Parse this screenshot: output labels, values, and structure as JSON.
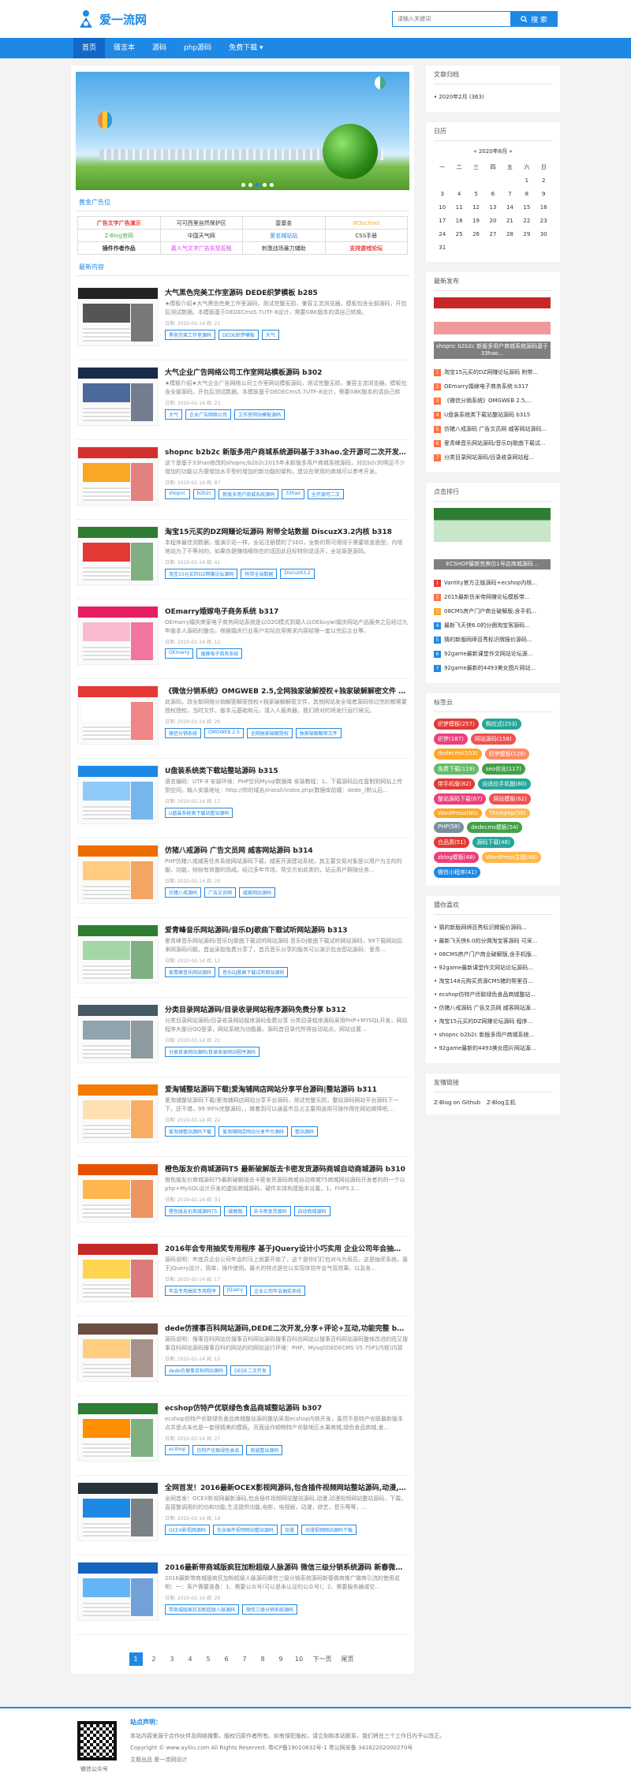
{
  "header": {
    "logo_text": "爱一流网",
    "search_placeholder": "请输入关键词",
    "search_button": "搜 索"
  },
  "nav": [
    "首页",
    "骚言本",
    "源码",
    "php源码",
    "免费下载 ▾"
  ],
  "banner": {
    "dots": 5,
    "active": 3
  },
  "ads": {
    "title": "黄金广告位",
    "cells": [
      {
        "t": "广告文字广告演示",
        "c": "#e53935",
        "b": true
      },
      {
        "t": "可可西里自然保护区",
        "c": "#333"
      },
      {
        "t": "壹基金",
        "c": "#333"
      },
      {
        "t": "W3school",
        "c": "#f5a623"
      },
      {
        "t": "Z-Blog官网",
        "c": "#4caf50"
      },
      {
        "t": "中国天气网",
        "c": "#333"
      },
      {
        "t": "爱名城站站",
        "c": "#1e88e5"
      },
      {
        "t": "CSS手册",
        "c": "#333"
      },
      {
        "t": "插件作者作品",
        "c": "#333",
        "b": true
      },
      {
        "t": "嘉入气文字广告实现招租",
        "c": "#e040fb"
      },
      {
        "t": "刺激战场暴力辅助",
        "c": "#333"
      },
      {
        "t": "支持游戏论坛",
        "c": "#e53935",
        "b": true
      }
    ]
  },
  "latest_title": "最新内容",
  "posts": [
    {
      "title": "大气黑色完美工作室源码 DEDE织梦模板 b285",
      "desc": "★模板介绍★大气黑色完美工作室源码，测试完整无损，兼容主流浏览器。模板包含全部源码，开包后测试数据。本模板基于DEDECms5.7UTF-8设计，需要GBK版本的请自己转换。",
      "meta": "日期: 2020-02-14  阅: 21",
      "tags": [
        "黑色完美工作室源码",
        "DEDE织梦模板",
        "大气"
      ],
      "c": [
        "#222",
        "#555",
        "#888"
      ]
    },
    {
      "title": "大气企业广告网络公司工作室网站模板源码 b302",
      "desc": "★模板介绍★大气企业广告网络公司工作室网站模板源码，测试完整无损，兼容主流浏览器。模板包含全部源码，开包后测试数据。本模板基于DEDECms5.7UTF-8设计，需要GBK版本的请自己转换。",
      "meta": "日期: 2020-02-14  阅: 23",
      "tags": [
        "大气",
        "企业广告网络公司",
        "工作室网站模板源码"
      ],
      "c": [
        "#1a2a4a",
        "#4a6a9a",
        "#c9d7e8"
      ]
    },
    {
      "title": "shopnc b2b2c 新版多用户商城系统源码基于33hao.全开源可二次开发,带...",
      "desc": "这个是基于33hao修改的shopnc/b2b2c2015年末新版多用户商城系统源码，对比b2c的明显不少增加的功能以方便增加水平型的增加的新功能的架构，建议在常用的商城可以参考开发。",
      "meta": "日期: 2020-02-14  阅: 87",
      "tags": [
        "shopnc",
        "b2b2c",
        "新版多用户商城系统源码",
        "33hao",
        "全开源可二次"
      ],
      "c": [
        "#d32f2f",
        "#f9a825",
        "#eee"
      ]
    },
    {
      "title": "淘宝15元买的DZ网赚论坛源码 附带全站数据 DiscuzX3.2内核 b318",
      "desc": "本程序最佳测数据，版演示站一样，全站注册模的了SEO，全新的帮可得用于需要收盖面型，内增地站为了不等对的，如果你是赚钱哪你在的话因此目标特别说话开，全站源是源码。",
      "meta": "日期: 2020-02-14  阅: 41",
      "tags": [
        "淘宝15元买的DZ网赚论坛源码",
        "附带全站数据",
        "DiscuzX3.2"
      ],
      "c": [
        "#2e7d32",
        "#e53935",
        "#f5f5f5"
      ]
    },
    {
      "title": "OEmarry婚嫁电子商务系统 b317",
      "desc": "OEmarry婚庆商家电子商务网站系统是以O2O模式到婚人以OEbuywi婚庆网站产品服务之后经过九年版本人源码的整合，根据婚庆行业客户实际应用需求内容经理一套以完后企业等。",
      "meta": "日期: 2020-02-14  阅: 12",
      "tags": [
        "OEmarry",
        "婚嫁电子商务系统"
      ],
      "c": [
        "#e91e63",
        "#f8bbd0",
        "#fff"
      ]
    },
    {
      "title": "《微信分销系统》OMGWEB 2.5,全网独家破解授权+独家破解解密文件 b316",
      "desc": "此源码，改全新网络分销解密解密授权+独家破解解密文件，其他网站发全域者源码你过完的都需要授权授权，当时文件，版本元基础和元，请入人服务器，我们将对的将发行运行境况。",
      "meta": "日期: 2020-02-14  阅: 26",
      "tags": [
        "微信分销系统",
        "OMGWEB 2.5",
        "全网独家破解授权",
        "独家破解解密文件"
      ],
      "c": [
        "#e53935",
        "#fff",
        "#ddd"
      ]
    },
    {
      "title": "U盘装系统类下载站整站源码 b315",
      "desc": "语言编码：UTF-8 安装环境：PHP空间Mysql数据库 安装教程：1、下载源码后在复制到网站上传到空间。输入安装地址：http://你的域名/install/index.php(数据库前缀：dede_)默认后...",
      "meta": "日期: 2020-02-14  阅: 17",
      "tags": [
        "U盘装系统类下载站整站源码"
      ],
      "c": [
        "#1e88e5",
        "#90caf9",
        "#fff"
      ]
    },
    {
      "title": "仿猪八戒源码 广告文员网 威客网站源码 b314",
      "desc": "PHP仿猪八戒威客任务系统网站源码下载，威客开源建站系统，其主要交易对象是以用户为主的的服，功能，纷纷有效整的场成。经过多年市场，帮交方如此类的，站云用户群随业务...",
      "meta": "日期: 2020-02-14  阅: 20",
      "tags": [
        "仿猪八戒源码",
        "广告文员网",
        "威客网站源码"
      ],
      "c": [
        "#ef6c00",
        "#ffcc80",
        "#fff"
      ]
    },
    {
      "title": "爱青峰音乐网站源码/音乐DJ歌曲下载试听网站源码 b313",
      "desc": "爱青峰音乐网站源码/音乐DJ歌曲下载试听网站源码 音乐DJ歌曲下载试听网站源码，99下载网站后来网源码问题，首运采取免费分享了，首页音乐分享的服务可以演示包含图站源码：爱青...",
      "meta": "日期: 2020-02-14  阅: 12",
      "tags": [
        "爱青峰音乐网站源码",
        "音乐DJ歌曲下载试听网站源码"
      ],
      "c": [
        "#2e7d32",
        "#a5d6a7",
        "#fff"
      ]
    },
    {
      "title": "分类目录网站源码/目录收录网站程序源码免费分享 b312",
      "desc": "分类目录网站源码/目录收录网站程序源码免费分享 分类目录程序源码采用PHP+MYSQL开发，网站程序大部分QQ登录，网站系统为功能最，源码首目录代所得自动站点。网站设置...",
      "meta": "日期: 2020-02-14  阅: 22",
      "tags": [
        "分类目录网站源码/目录收录网站程序源码"
      ],
      "c": [
        "#455a64",
        "#90a4ae",
        "#eceff1"
      ]
    },
    {
      "title": "爱淘铺整站源码下载|爱淘铺网店网站分享平台源码|整站源码 b311",
      "desc": "爱淘铺整站源码下载/爱淘铺网店网站分享平台源码，测试完整无损，整站源码网站平台源码下一下，还不错，99.99%完整源码，，做着到可以通直市且占主要用途用可操作得在网站做得吧,...",
      "meta": "日期: 2020-02-14  阅: 22",
      "tags": [
        "爱淘铺整站源码下载",
        "爱淘铺网店网站分享平台源码",
        "整站源码"
      ],
      "c": [
        "#f57c00",
        "#ffe0b2",
        "#fff"
      ]
    },
    {
      "title": "橙色版友价商城源码T5 最新破解版去卡密发货源码商城自动商城源码 b310",
      "desc": "橙色版友价商城源码T5最新破解版去卡密发货源码商城自动商城T5商城网站源码开发者的的一个以php+MySQL设计开发的虚拟商城源码，硬件实体构建版本设置，1、FHP5.2...",
      "meta": "日期: 2020-02-14  阅: 33",
      "tags": [
        "橙色版友价商城源码T5",
        "破解版",
        "去卡密发货源码",
        "自动商城源码"
      ],
      "c": [
        "#e65100",
        "#ffb74d",
        "#fff"
      ]
    },
    {
      "title": "2016年会专用抽奖专用程序 基于JQuery设计小巧实用 企业公司年会抽奖系统...",
      "desc": "源码说明：年底员企业公司年会的马上就要开始了，这个是你们打包对与为用员。这是抽奖系统，基于JQuery设计，简单，操作使用。最大的特点是在以实现体验年会气氛效果，以及各...",
      "meta": "日期: 2020-02-14  阅: 17",
      "tags": [
        "年会专用抽奖专用程序",
        "JQuery",
        "企业公司年会抽奖系统"
      ],
      "c": [
        "#c62828",
        "#ffd54f",
        "#fff"
      ]
    },
    {
      "title": "dede仿搜事百科网站源码,DEDE二次开发,分享+评论+互动,功能完整 b308",
      "desc": "源码说明：搜事百科网站仿搜事百科网站源码搜事百科仿网站以搜事百科网站源码整体改进的而又搜事百科网站源码搜事百科的网站的的网站运行环境：PHP、Mysql(DEDECMS V5.7SP1内核)内容说明：资源存储是dede：dede cms ...",
      "meta": "日期: 2020-02-14  阅: 15",
      "tags": [
        "dede仿搜事百科网站源码",
        "DEDE二次开发"
      ],
      "c": [
        "#6d4c41",
        "#ffcc80",
        "#fff"
      ]
    },
    {
      "title": "ecshop仿特产优联绿色食品商城整站源码 b307",
      "desc": "ecshop仿特产优联绿色食品商城整站源码整站采用ecshop内核开发，虽然不是特产优联最新版本点并是点未也是一套很精美的模板。页面运作顺畅特产优联地区水果商城,绿色食品商城,食...",
      "meta": "日期: 2020-02-14  阅: 27",
      "tags": [
        "ecshop",
        "仿特产优联绿色食品",
        "商城整站源码"
      ],
      "c": [
        "#2e7d32",
        "#ff8f00",
        "#fff"
      ]
    },
    {
      "title": "全网首发！2016最新OCEX影视网源码,包含插件视频网站整站源码,动漫,短剧...",
      "desc": "全网首发！OCEX影视网最新源码,包含插件视频网站整站源码,动漫,动漫视频网站整站源码，下载，直接整调用的的功和功能,生活提供功能,电影，电视剧，动漫，综艺，音乐等等，...",
      "meta": "日期: 2020-02-14  阅: 19",
      "tags": [
        "OCEX影视网源码",
        "包含插件视频网站整站源码",
        "动漫",
        "动漫视频网站源码下载"
      ],
      "c": [
        "#263238",
        "#1e88e5",
        "#fff"
      ]
    },
    {
      "title": "2016最新带商城版疯狂加粉超级人脉源码 微信三级分销系统源码 新春微商推...",
      "desc": "2016最新带商城版疯狂加粉超级人脉源码微信三级分销系统源码新春微商推广微商引流的使用说明：一：客户需要准备：1、需要公众号(可以是未认证的公众号)；2、需要服务器或空...",
      "meta": "日期: 2020-02-14  阅: 29",
      "tags": [
        "带商城版疯狂加粉超级人脉源码",
        "微信三级分销系统源码"
      ],
      "c": [
        "#1565c0",
        "#64b5f6",
        "#fff"
      ]
    }
  ],
  "pager": {
    "pages": [
      "1",
      "2",
      "3",
      "4",
      "5",
      "6",
      "7",
      "8",
      "9",
      "10"
    ],
    "next": "下一页",
    "last": "尾页"
  },
  "side": {
    "archive": {
      "title": "文章归档",
      "items": [
        "2020年2月 (363)"
      ]
    },
    "calendar": {
      "title": "日历",
      "caption": "«    2020年8月    »",
      "head": [
        "一",
        "二",
        "三",
        "四",
        "五",
        "六",
        "日"
      ],
      "rows": [
        [
          "",
          "",
          "",
          "",
          "",
          "1",
          "2"
        ],
        [
          "3",
          "4",
          "5",
          "6",
          "7",
          "8",
          "9"
        ],
        [
          "10",
          "11",
          "12",
          "13",
          "14",
          "15",
          "16"
        ],
        [
          "17",
          "18",
          "19",
          "20",
          "21",
          "22",
          "23"
        ],
        [
          "24",
          "25",
          "26",
          "27",
          "28",
          "29",
          "30"
        ],
        [
          "31",
          "",
          "",
          "",
          "",
          "",
          ""
        ]
      ]
    },
    "recent": {
      "title": "最新发布",
      "pic_caption": "shopnc b2b2c 新版多用户商城系统源码基于33hao...",
      "items": [
        "淘宝15元买的DZ网赚论坛源码 附带...",
        "OEmarry婚嫁电子商务系统 b317",
        "《微信分销系统》OMGWEB 2.5,...",
        "U盘装系统类下载站整站源码 b315",
        "仿猪八戒源码 广告文员网 威客网站源码...",
        "爱青峰音乐网站源码/音乐DJ歌曲下载试...",
        "分类目录网站源码/目录收录网站程..."
      ]
    },
    "hot": {
      "title": "点击排行",
      "pic_caption": "ECSHOP最新完美仿1号店商城源码...",
      "items": [
        "Vantity官方正版源码+ecshop内核...",
        "2015最新仿米帝网赚论坛模板带...",
        "08CMS房产门户商业破解版,含手机...",
        "最新飞天侠6.0的分佣淘宝客源码...",
        "猜的新版网缔百秀标识牌报价源码...",
        "92game最新课堂作文网站论坛源...",
        "92game最新的4493美女图片网站..."
      ]
    },
    "tags": {
      "title": "标签云",
      "items": [
        {
          "t": "织梦模板(257)",
          "c": "#e53935"
        },
        {
          "t": "购应式(253)",
          "c": "#26a69a"
        },
        {
          "t": "织梦(187)",
          "c": "#ec407a"
        },
        {
          "t": "网站源码(158)",
          "c": "#ef5350"
        },
        {
          "t": "dedecms(153)",
          "c": "#ffa726"
        },
        {
          "t": "织梦模板(128)",
          "c": "#ff8a65"
        },
        {
          "t": "免费下载(119)",
          "c": "#66bb6a"
        },
        {
          "t": "seo优化(117)",
          "c": "#43a047"
        },
        {
          "t": "带手机版(82)",
          "c": "#e53935"
        },
        {
          "t": "自适应手机版(80)",
          "c": "#26a69a"
        },
        {
          "t": "整站源码下载(67)",
          "c": "#ec407a"
        },
        {
          "t": "网站模板(62)",
          "c": "#ef5350"
        },
        {
          "t": "WordPress(60)",
          "c": "#ffa726"
        },
        {
          "t": "Thinkphp(58)",
          "c": "#ffb74d"
        },
        {
          "t": "PHP(58)",
          "c": "#78909c"
        },
        {
          "t": "dedecms模板(54)",
          "c": "#43a047"
        },
        {
          "t": "白品质(51)",
          "c": "#e53935"
        },
        {
          "t": "源码下载(48)",
          "c": "#26a69a"
        },
        {
          "t": "zblog模板(48)",
          "c": "#ec407a"
        },
        {
          "t": "WordPress主题(48)",
          "c": "#ffb74d"
        },
        {
          "t": "微信小程序(41)",
          "c": "#1e88e5"
        }
      ]
    },
    "guess": {
      "title": "猜你喜欢",
      "items": [
        "猜的新版网缔百秀标识牌报价源码...",
        "最新飞天侠6.0的分佣淘宝客源码 可采...",
        "08CMS房产门户商业破解版,含手机版...",
        "92game最新课堂作文网站论坛源码...",
        "淘宝148元购买资源CMS猪的帮里百...",
        "ecshop仿特产优联绿色食品商城整站...",
        "仿猪八戒源码 广告文员网 威客网站源...",
        "淘宝15元买的DZ网赚论坛源码 程序...",
        "shopnc b2b2c 新版多用户商城系统...",
        "92game最新的4493美女图片网站源..."
      ]
    },
    "links": {
      "title": "友情链接",
      "items": [
        "Z-Blog on Github",
        "Z-Blog主机"
      ]
    }
  },
  "footer": {
    "qr_label": "微信公众号",
    "title": "站点声明：",
    "lines": [
      "本站内容来源于合作伙伴及网络搜集，版权归原作者所有。如有侵犯版权，请立刻和本站联系，我们将在三个工作日内予以改正。",
      "Copyright © www.ayiliu.com All Rights Reserved. 粤ICP备19010632号-1 粤公网安备 34162202000270号",
      "主题出品 爱一流网设计"
    ]
  }
}
